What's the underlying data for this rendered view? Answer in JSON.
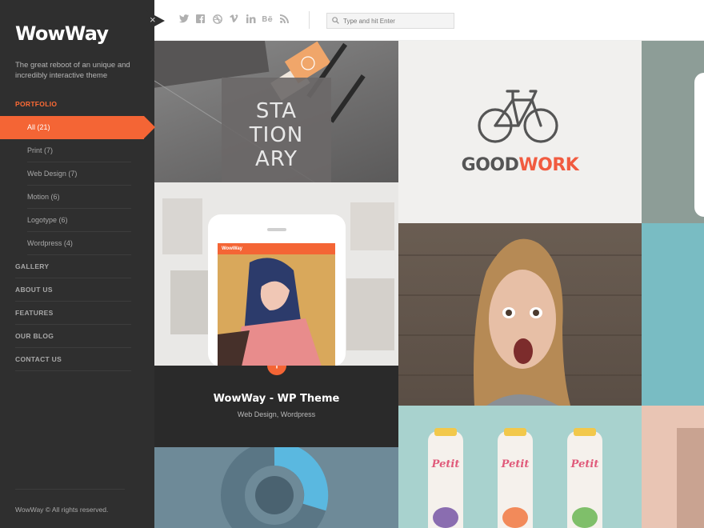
{
  "app": {
    "logo": "WowWay",
    "tagline": "The great reboot of an unique and incredibly interactive theme"
  },
  "nav": {
    "portfolio": "PORTFOLIO",
    "portfolio_items": [
      {
        "label": "All (21)",
        "active": true
      },
      {
        "label": "Print (7)"
      },
      {
        "label": "Web Design (7)"
      },
      {
        "label": "Motion (6)"
      },
      {
        "label": "Logotype (6)"
      },
      {
        "label": "Wordpress (4)"
      }
    ],
    "sections": [
      "GALLERY",
      "ABOUT US",
      "FEATURES",
      "OUR BLOG",
      "CONTACT US"
    ]
  },
  "close_glyph": "×",
  "social_icons": [
    "twitter-icon",
    "facebook-icon",
    "dribbble-icon",
    "vimeo-icon",
    "linkedin-icon",
    "behance-icon",
    "rss-icon"
  ],
  "search": {
    "placeholder": "Type and hit Enter"
  },
  "tiles": {
    "stationary": {
      "lines": [
        "STA",
        "TION",
        "ARY"
      ]
    },
    "goodwork": {
      "good": "GOOD",
      "work": "WORK"
    },
    "device": {
      "screen_logo": "WowWay"
    },
    "caption": {
      "title": "WowWay - WP Theme",
      "subtitle": "Web Design, Wordpress"
    },
    "bottles": {
      "label": "Petit"
    }
  },
  "footer": {
    "copyright": "WowWay © All rights reserved."
  },
  "colors": {
    "accent": "#f46535",
    "sidebar": "#2f2f2f"
  }
}
